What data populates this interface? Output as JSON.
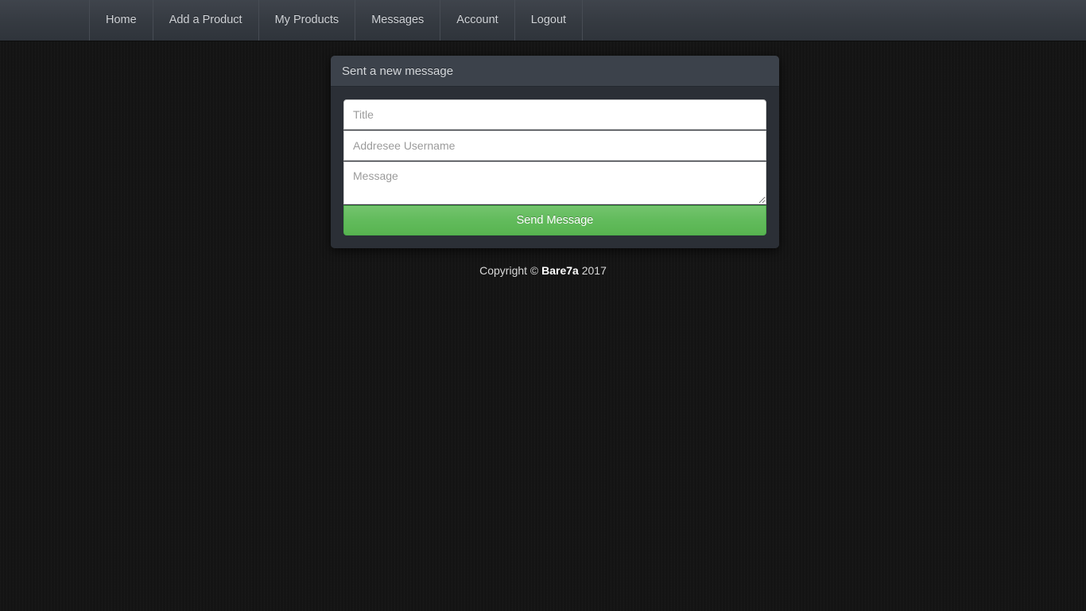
{
  "navbar": {
    "items": [
      {
        "label": "Home",
        "name": "nav-item-home"
      },
      {
        "label": "Add a Product",
        "name": "nav-item-add-a-product"
      },
      {
        "label": "My Products",
        "name": "nav-item-my-products"
      },
      {
        "label": "Messages",
        "name": "nav-item-messages"
      },
      {
        "label": "Account",
        "name": "nav-item-account"
      },
      {
        "label": "Logout",
        "name": "nav-item-logout"
      }
    ]
  },
  "panel": {
    "title": "Sent a new message",
    "form": {
      "title_field": {
        "placeholder": "Title",
        "value": ""
      },
      "addressee_field": {
        "placeholder": "Addresee Username",
        "value": ""
      },
      "message_field": {
        "placeholder": "Message",
        "value": ""
      },
      "submit_label": "Send Message"
    }
  },
  "footer": {
    "prefix": "Copyright © ",
    "brand": "Bare7a",
    "year": " 2017"
  },
  "colors": {
    "navbar_top": "#3f444c",
    "navbar_bottom": "#2f343b",
    "panel_heading": "#3c424b",
    "panel_body": "#2b2f36",
    "page_background": "#141414",
    "accent_green": "#62bb5c",
    "text_light": "#cfd2d6"
  }
}
